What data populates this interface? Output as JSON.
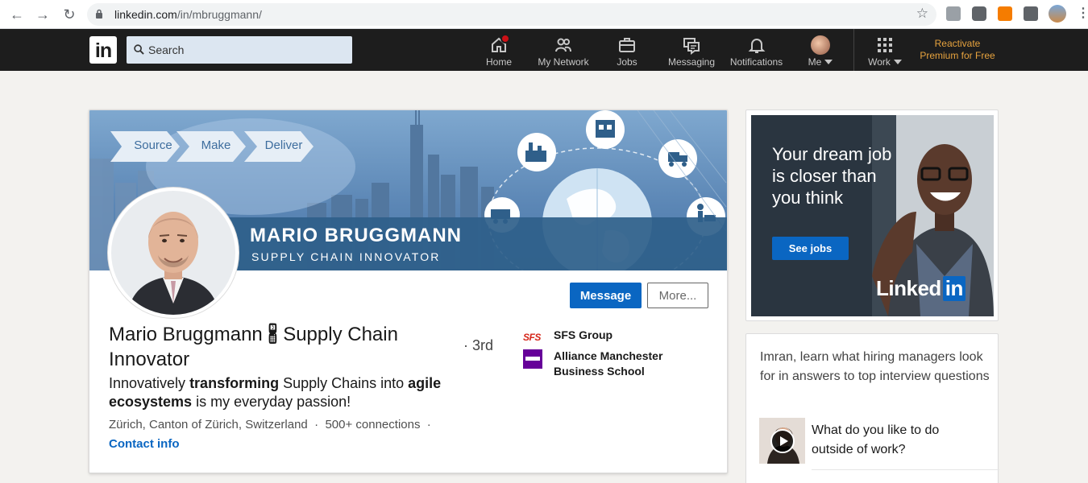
{
  "browser": {
    "url_host": "linkedin.com",
    "url_path": "/in/mbruggmann/"
  },
  "nav": {
    "logo": "in",
    "search_placeholder": "Search",
    "items": [
      {
        "label": "Home",
        "icon": "home-icon"
      },
      {
        "label": "My Network",
        "icon": "network-icon"
      },
      {
        "label": "Jobs",
        "icon": "briefcase-icon"
      },
      {
        "label": "Messaging",
        "icon": "messaging-icon"
      },
      {
        "label": "Notifications",
        "icon": "bell-icon"
      },
      {
        "label": "Me",
        "icon": "avatar-icon"
      },
      {
        "label": "Work",
        "icon": "grid-icon"
      }
    ],
    "premium_line1": "Reactivate",
    "premium_line2": "Premium for Free",
    "colors": {
      "bar": "#1d1d1d",
      "premium": "#e7a33e",
      "badge": "#cc1016"
    }
  },
  "banner": {
    "steps": [
      "Source",
      "Make",
      "Deliver"
    ],
    "name": "MARIO BRUGGMANN",
    "role": "SUPPLY CHAIN INNOVATOR"
  },
  "profile": {
    "name": "Mario Bruggmann 🖁 Supply Chain Innovator",
    "degree": "· 3rd",
    "headline_parts": [
      "Innovatively ",
      "transforming",
      " Supply Chains into ",
      "agile ecosystems",
      " is my everyday passion!"
    ],
    "location": "Zürich, Canton of Zürich, Switzerland",
    "connections": "500+ connections",
    "contact_label": "Contact info",
    "message_label": "Message",
    "more_label": "More...",
    "companies": [
      {
        "name": "SFS Group",
        "logo_text": "SFS"
      },
      {
        "name": "Alliance Manchester Business School",
        "logo_text": ""
      }
    ],
    "accent": "#0a66c2"
  },
  "ad": {
    "headline": "Your dream job is closer than you think",
    "button": "See jobs",
    "brand": "Linked",
    "brand_in": "in"
  },
  "interview": {
    "intro": "Imran, learn what hiring managers look for in answers to top interview questions",
    "question": "What do you like to do outside of work?"
  }
}
